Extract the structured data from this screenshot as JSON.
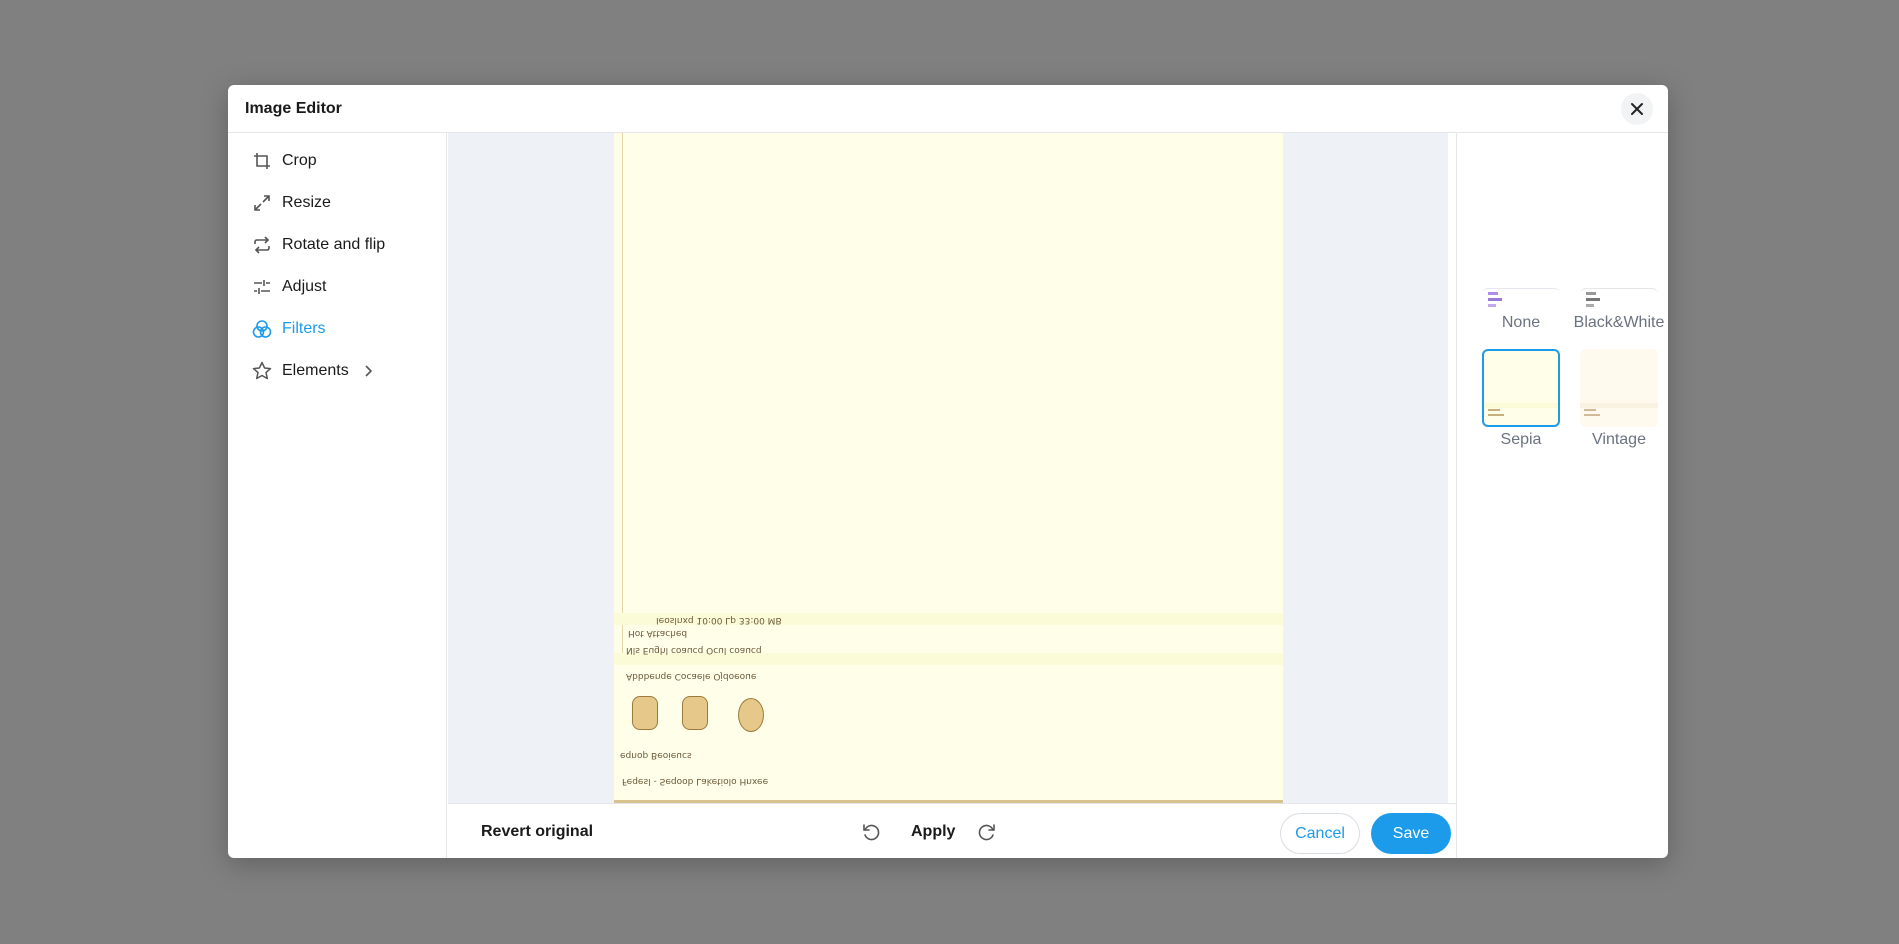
{
  "dialog": {
    "title": "Image Editor",
    "close_icon": "close-icon"
  },
  "sidebar": {
    "items": [
      {
        "label": "Crop",
        "icon": "crop-icon"
      },
      {
        "label": "Resize",
        "icon": "resize-icon"
      },
      {
        "label": "Rotate and flip",
        "icon": "rotate-flip-icon"
      },
      {
        "label": "Adjust",
        "icon": "sliders-icon"
      },
      {
        "label": "Filters",
        "icon": "filters-icon",
        "active": true
      },
      {
        "label": "Elements",
        "icon": "star-icon",
        "has_submenu": true
      }
    ]
  },
  "filters": {
    "items": [
      {
        "label": "None"
      },
      {
        "label": "Black&White"
      },
      {
        "label": "Sepia",
        "selected": true
      },
      {
        "label": "Vintage"
      }
    ]
  },
  "preview": {
    "flipped_text": [
      "Ieoslnxq  10:00 Lp          33:00 MB",
      "Hot Attached",
      "Nls          Eughl  coaucq          Ocul  coaucq",
      "Abbbenqe     Cocaele     Ojdoeoue",
      "eqnop Beoieucs",
      "Feqesl - Seqoob Laketiolo Hnxee"
    ]
  },
  "footer": {
    "revert_label": "Revert original",
    "apply_label": "Apply",
    "cancel_label": "Cancel",
    "save_label": "Save",
    "undo_icon": "undo-icon",
    "redo_icon": "redo-icon"
  },
  "colors": {
    "accent": "#1c9bea",
    "backdrop": "#808080",
    "sepia_bg": "#fffee9"
  }
}
